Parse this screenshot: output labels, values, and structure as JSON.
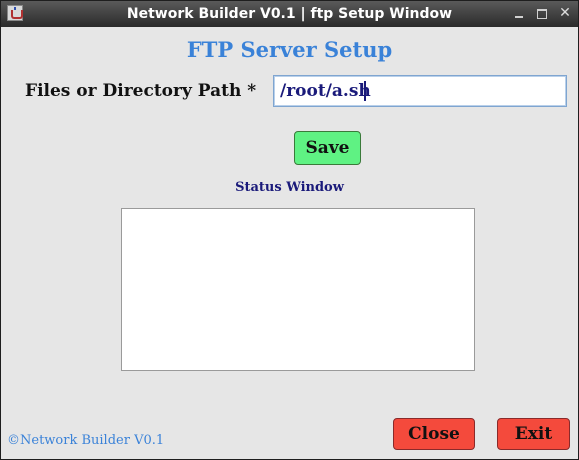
{
  "window": {
    "title": "Network Builder V0.1 | ftp Setup Window",
    "icon": "java-cup-icon",
    "controls": {
      "minimize_icon": "minimize-icon",
      "maximize_icon": "maximize-icon",
      "close_glyph": "✕"
    }
  },
  "form": {
    "heading": "FTP Server Setup",
    "path_label": "Files or Directory Path *",
    "path_value": "/root/a.sh",
    "save_label": "Save"
  },
  "status": {
    "label": "Status Window",
    "content": ""
  },
  "footer": {
    "copyright": "©Network Builder V0.1",
    "close_label": "Close",
    "exit_label": "Exit"
  },
  "colors": {
    "heading": "#3a82d8",
    "save_button": "#5ff283",
    "danger_button": "#f44a3c",
    "status_label": "#1a1a7a"
  }
}
